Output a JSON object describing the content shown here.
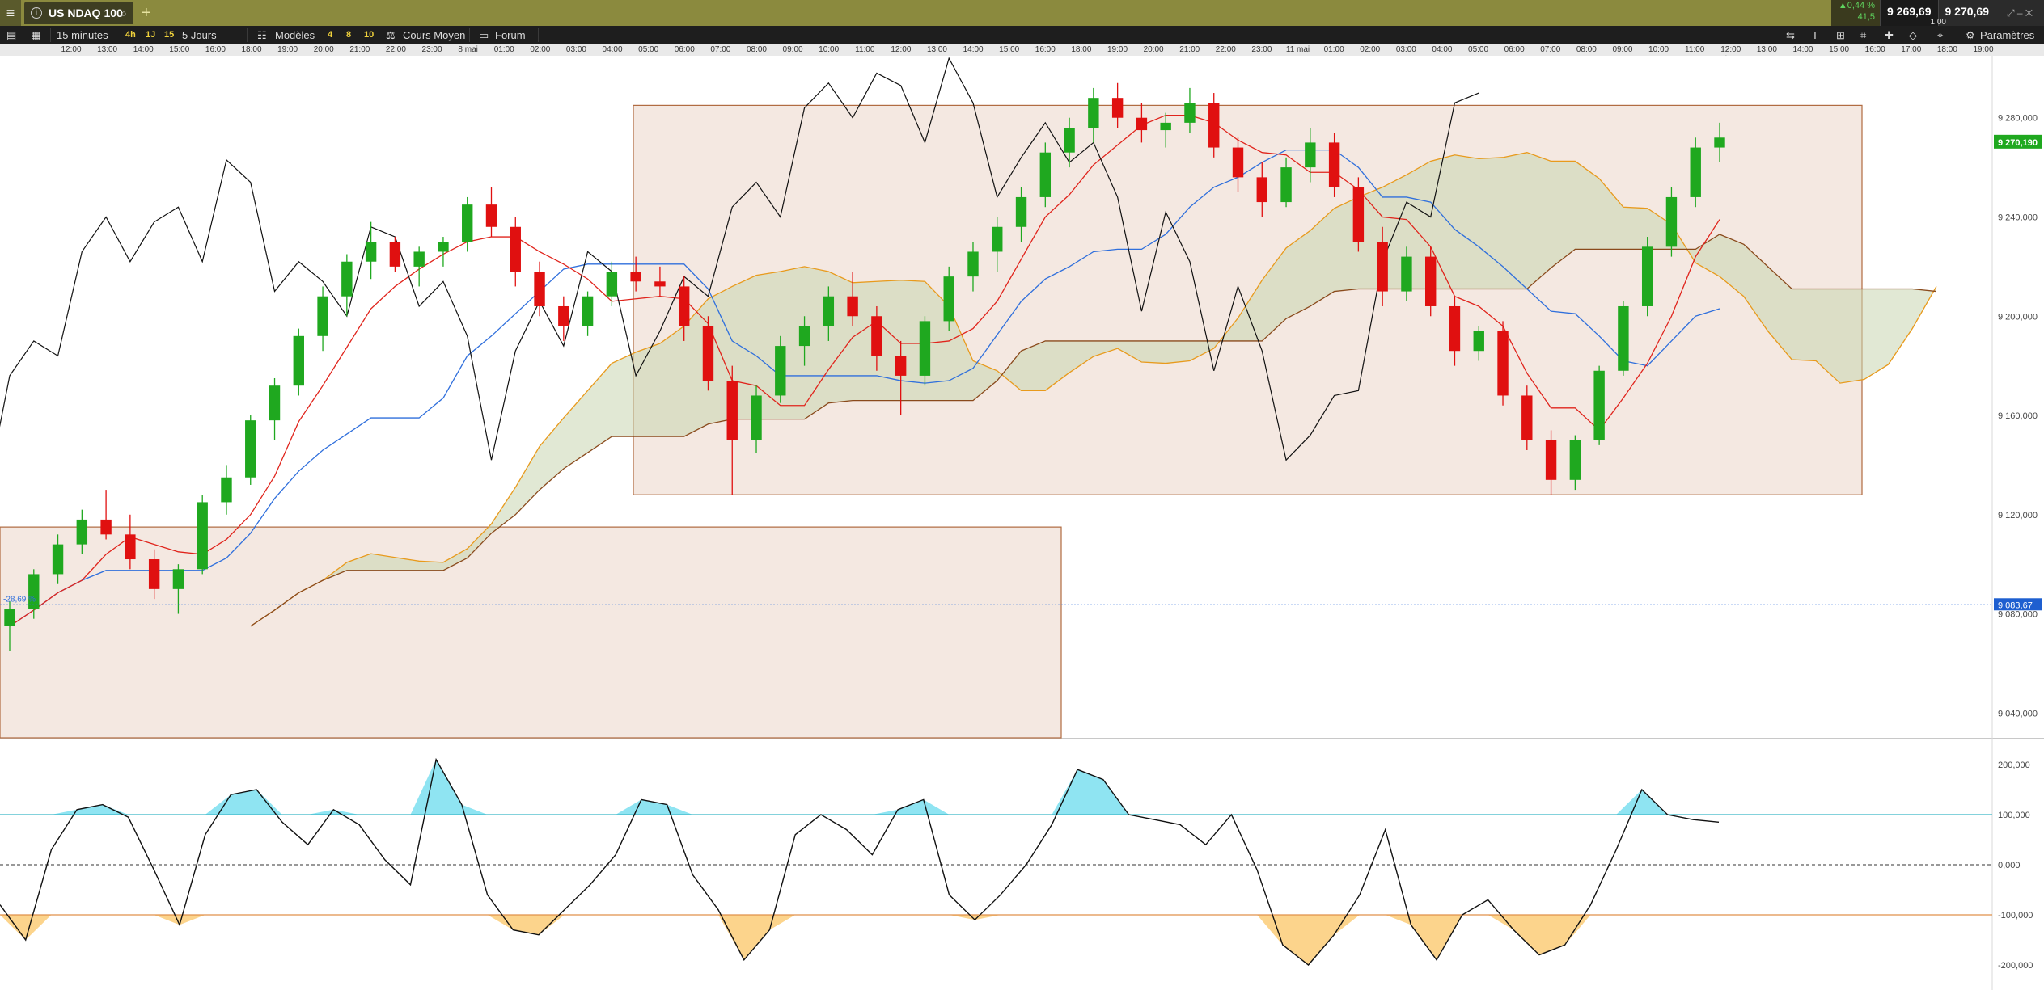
{
  "titlebar": {
    "menu_icon": "hamburger-icon",
    "tab_title": "US NDAQ 100",
    "add_tab": "+",
    "change_pct": "▲0,44 %",
    "change_abs": "41,5",
    "bid": "9 269,69",
    "ask": "9 270,69",
    "spread": "1,00"
  },
  "toolbar": {
    "timeframe": "15 minutes",
    "quick_periods": [
      "4h",
      "1J",
      "15"
    ],
    "range": "5 Jours",
    "templates": "Modèles",
    "template_counts": [
      "4",
      "8",
      "10"
    ],
    "avg_price": "Cours Moyen",
    "forum": "Forum",
    "settings": "Paramètres"
  },
  "time_axis": [
    "12:00",
    "13:00",
    "14:00",
    "15:00",
    "16:00",
    "18:00",
    "19:00",
    "20:00",
    "21:00",
    "22:00",
    "23:00",
    "8 mai",
    "01:00",
    "02:00",
    "03:00",
    "04:00",
    "05:00",
    "06:00",
    "07:00",
    "08:00",
    "09:00",
    "10:00",
    "11:00",
    "12:00",
    "13:00",
    "14:00",
    "15:00",
    "16:00",
    "18:00",
    "19:00",
    "20:00",
    "21:00",
    "22:00",
    "23:00",
    "11 mai",
    "01:00",
    "02:00",
    "03:00",
    "04:00",
    "05:00",
    "06:00",
    "07:00",
    "08:00",
    "09:00",
    "10:00",
    "11:00",
    "12:00",
    "13:00",
    "14:00",
    "15:00",
    "16:00",
    "17:00",
    "18:00",
    "19:00"
  ],
  "price_axis": [
    "9 280,000",
    "9 240,000",
    "9 200,000",
    "9 160,000",
    "9 120,000",
    "9 080,000",
    "9 040,000"
  ],
  "last_price_label": "9 270,190",
  "level_label": "9 083,67",
  "cursor_label": "-28,69 %",
  "cci_axis": [
    "200,000",
    "100,000",
    "0,000",
    "-100,000",
    "-200,000"
  ],
  "colors": {
    "bull": "#1fa81f",
    "bear": "#e01010",
    "tenkan": "#e0241c",
    "kijun": "#2f6fdc",
    "chikou": "#111111",
    "span_a": "#e89a1c",
    "span_b": "#8a4a1c",
    "box_fill": "#f2e4dc",
    "box_stroke": "#b06a40",
    "cci_up": "#8fe4f2",
    "cci_down": "#fcd48c",
    "cci_line_up": "#3ab6c8",
    "cci_line_down": "#e0904a"
  },
  "chart_data": {
    "type": "candlestick",
    "symbol": "US NDAQ 100",
    "interval": "15 minutes",
    "ylim": [
      9030,
      9305
    ],
    "cci_ylim": [
      -250,
      250
    ],
    "cci_levels": [
      100,
      0,
      -100
    ],
    "candles": [
      [
        9075,
        9085,
        9065,
        9082
      ],
      [
        9082,
        9098,
        9078,
        9096
      ],
      [
        9096,
        9112,
        9092,
        9108
      ],
      [
        9108,
        9122,
        9104,
        9118
      ],
      [
        9118,
        9130,
        9110,
        9112
      ],
      [
        9112,
        9120,
        9098,
        9102
      ],
      [
        9102,
        9106,
        9086,
        9090
      ],
      [
        9090,
        9100,
        9080,
        9098
      ],
      [
        9098,
        9128,
        9096,
        9125
      ],
      [
        9125,
        9140,
        9120,
        9135
      ],
      [
        9135,
        9160,
        9132,
        9158
      ],
      [
        9158,
        9175,
        9150,
        9172
      ],
      [
        9172,
        9195,
        9168,
        9192
      ],
      [
        9192,
        9212,
        9186,
        9208
      ],
      [
        9208,
        9225,
        9200,
        9222
      ],
      [
        9222,
        9238,
        9215,
        9230
      ],
      [
        9230,
        9232,
        9218,
        9220
      ],
      [
        9220,
        9228,
        9212,
        9226
      ],
      [
        9226,
        9232,
        9220,
        9230
      ],
      [
        9230,
        9248,
        9226,
        9245
      ],
      [
        9245,
        9252,
        9232,
        9236
      ],
      [
        9236,
        9240,
        9212,
        9218
      ],
      [
        9218,
        9222,
        9200,
        9204
      ],
      [
        9204,
        9208,
        9190,
        9196
      ],
      [
        9196,
        9210,
        9192,
        9208
      ],
      [
        9208,
        9222,
        9204,
        9218
      ],
      [
        9218,
        9224,
        9210,
        9214
      ],
      [
        9214,
        9220,
        9208,
        9212
      ],
      [
        9212,
        9216,
        9190,
        9196
      ],
      [
        9196,
        9200,
        9170,
        9174
      ],
      [
        9174,
        9180,
        9128,
        9150
      ],
      [
        9150,
        9172,
        9145,
        9168
      ],
      [
        9168,
        9192,
        9165,
        9188
      ],
      [
        9188,
        9200,
        9180,
        9196
      ],
      [
        9196,
        9212,
        9190,
        9208
      ],
      [
        9208,
        9218,
        9196,
        9200
      ],
      [
        9200,
        9204,
        9178,
        9184
      ],
      [
        9184,
        9190,
        9160,
        9176
      ],
      [
        9176,
        9200,
        9172,
        9198
      ],
      [
        9198,
        9220,
        9194,
        9216
      ],
      [
        9216,
        9230,
        9210,
        9226
      ],
      [
        9226,
        9240,
        9218,
        9236
      ],
      [
        9236,
        9252,
        9230,
        9248
      ],
      [
        9248,
        9270,
        9244,
        9266
      ],
      [
        9266,
        9280,
        9260,
        9276
      ],
      [
        9276,
        9292,
        9270,
        9288
      ],
      [
        9288,
        9294,
        9276,
        9280
      ],
      [
        9280,
        9286,
        9270,
        9275
      ],
      [
        9275,
        9282,
        9268,
        9278
      ],
      [
        9278,
        9292,
        9274,
        9286
      ],
      [
        9286,
        9290,
        9264,
        9268
      ],
      [
        9268,
        9272,
        9250,
        9256
      ],
      [
        9256,
        9262,
        9240,
        9246
      ],
      [
        9246,
        9264,
        9244,
        9260
      ],
      [
        9260,
        9276,
        9254,
        9270
      ],
      [
        9270,
        9274,
        9248,
        9252
      ],
      [
        9252,
        9256,
        9226,
        9230
      ],
      [
        9230,
        9236,
        9204,
        9210
      ],
      [
        9210,
        9228,
        9206,
        9224
      ],
      [
        9224,
        9228,
        9200,
        9204
      ],
      [
        9204,
        9208,
        9180,
        9186
      ],
      [
        9186,
        9196,
        9182,
        9194
      ],
      [
        9194,
        9198,
        9164,
        9168
      ],
      [
        9168,
        9172,
        9146,
        9150
      ],
      [
        9150,
        9154,
        9128,
        9134
      ],
      [
        9134,
        9152,
        9130,
        9150
      ],
      [
        9150,
        9180,
        9148,
        9178
      ],
      [
        9178,
        9206,
        9176,
        9204
      ],
      [
        9204,
        9232,
        9200,
        9228
      ],
      [
        9228,
        9252,
        9224,
        9248
      ],
      [
        9248,
        9272,
        9244,
        9268
      ],
      [
        9268,
        9278,
        9262,
        9272
      ]
    ],
    "cci": [
      -80,
      -150,
      30,
      110,
      120,
      95,
      -10,
      -120,
      60,
      140,
      150,
      85,
      40,
      110,
      80,
      10,
      -40,
      210,
      120,
      -60,
      -130,
      -140,
      -90,
      -40,
      20,
      130,
      120,
      -20,
      -90,
      -190,
      -130,
      60,
      100,
      70,
      20,
      110,
      130,
      -60,
      -110,
      -60,
      0,
      80,
      190,
      170,
      100,
      90,
      80,
      40,
      100,
      -10,
      -160,
      -200,
      -140,
      -60,
      70,
      -120,
      -190,
      -100,
      -70,
      -130,
      -180,
      -160,
      -80,
      30,
      150,
      100,
      90,
      85
    ],
    "boxes": [
      {
        "from_time": "04:00 (8 mai)",
        "to_time": "17:00 (11 mai)",
        "top": 9285,
        "bottom": 9128
      },
      {
        "from_time": "12:00",
        "to_time": "18:00 (8 mai)",
        "top": 9115,
        "bottom": 9030
      }
    ]
  }
}
